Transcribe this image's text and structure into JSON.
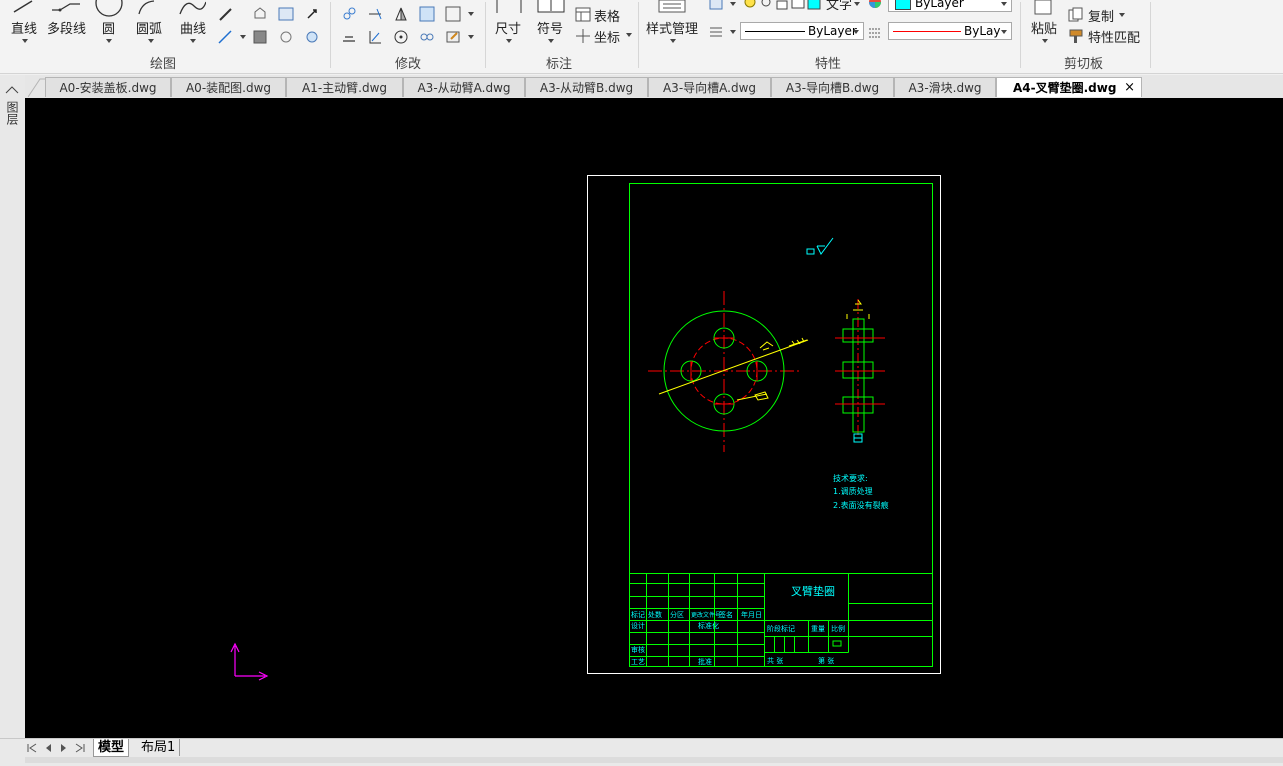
{
  "ribbon": {
    "draw": {
      "label": "绘图",
      "line": "直线",
      "polyline": "多段线",
      "circle": "圆",
      "arc": "圆弧",
      "spline": "曲线"
    },
    "modify": {
      "label": "修改"
    },
    "annotation": {
      "label": "标注",
      "dimension": "尺寸",
      "symbol": "符号",
      "table": "表格",
      "coordinate": "坐标"
    },
    "properties": {
      "label": "特性",
      "style_manager": "样式管理",
      "text_style": "文字",
      "color_value": "ByLayer",
      "linetype_value": "ByLayer",
      "lineweight_value": "ByLay"
    },
    "clipboard": {
      "label": "剪切板",
      "paste": "粘贴",
      "copy": "复制",
      "match_properties": "特性匹配"
    }
  },
  "left_panel": {
    "label": "图层"
  },
  "tabs": [
    {
      "label": "A0-安装盖板.dwg"
    },
    {
      "label": "A0-装配图.dwg"
    },
    {
      "label": "A1-主动臂.dwg"
    },
    {
      "label": "A3-从动臂A.dwg"
    },
    {
      "label": "A3-从动臂B.dwg"
    },
    {
      "label": "A3-导向槽A.dwg"
    },
    {
      "label": "A3-导向槽B.dwg"
    },
    {
      "label": "A3-滑块.dwg"
    },
    {
      "label": "A4-叉臂垫圈.dwg",
      "active": true
    }
  ],
  "close_symbol": "×",
  "drawing": {
    "title": "叉臂垫圈",
    "tech_req_title": "技术要求:",
    "tech_req_1": "1.调质处理",
    "tech_req_2": "2.表面没有裂痕",
    "tb_mark": "标记",
    "tb_count": "处数",
    "tb_zone": "分区",
    "tb_docno": "更改文件号",
    "tb_sign": "签名",
    "tb_date": "年月日",
    "tb_design": "设计",
    "tb_standard": "标准化",
    "tb_review": "审核",
    "tb_process": "工艺",
    "tb_approve": "批准",
    "tb_stage": "阶段标记",
    "tb_weight": "重量",
    "tb_scale": "比例",
    "tb_sheets": "共 张",
    "tb_sheet": "第 张"
  },
  "bottom": {
    "model_tab": "模型",
    "layout_tab": "布局1"
  },
  "colors": {
    "canvas": "#000000",
    "green": "#00ff00",
    "red": "#ff0000",
    "yellow": "#ffff00",
    "cyan": "#00ffff",
    "white": "#ffffff",
    "magenta": "#ff00ff"
  }
}
